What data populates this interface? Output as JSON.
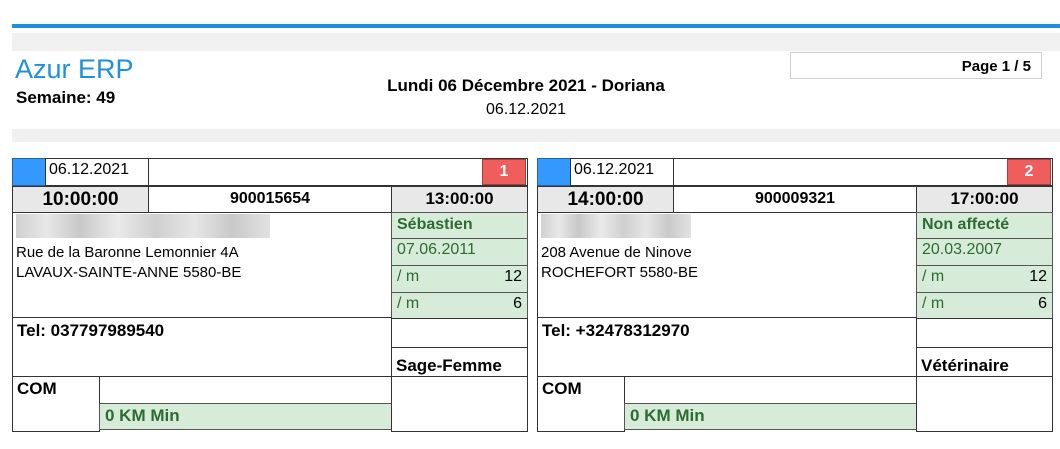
{
  "header": {
    "brand": "Azur ERP",
    "week": "Semaine: 49",
    "title": "Lundi  06 Décembre 2021 - Doriana",
    "date": "06.12.2021",
    "page": "Page 1 / 5"
  },
  "cards": [
    {
      "date": "06.12.2021",
      "number": "1",
      "start": "10:00:00",
      "reference": "900015654",
      "end": "13:00:00",
      "assignee": "Sébastien",
      "address_line1": "Rue de la Baronne Lemonnier 4A",
      "address_line2": "LAVAUX-SAINTE-ANNE 5580-BE",
      "date2": "07.06.2011",
      "unit1": "/ m",
      "val1": "12",
      "unit2": "/ m",
      "val2": "6",
      "tel": "Tel: 037797989540",
      "role": "Sage-Femme",
      "com": "COM",
      "km": "0 KM  Min"
    },
    {
      "date": "06.12.2021",
      "number": "2",
      "start": "14:00:00",
      "reference": "900009321",
      "end": "17:00:00",
      "assignee": "Non affecté",
      "address_line1": "208 Avenue de Ninove",
      "address_line2": "ROCHEFORT 5580-BE",
      "date2": "20.03.2007",
      "unit1": "/ m",
      "val1": "12",
      "unit2": "/ m",
      "val2": "6",
      "tel": "Tel: +32478312970",
      "role": "Vétérinaire",
      "com": "COM",
      "km": "0 KM  Min"
    }
  ]
}
